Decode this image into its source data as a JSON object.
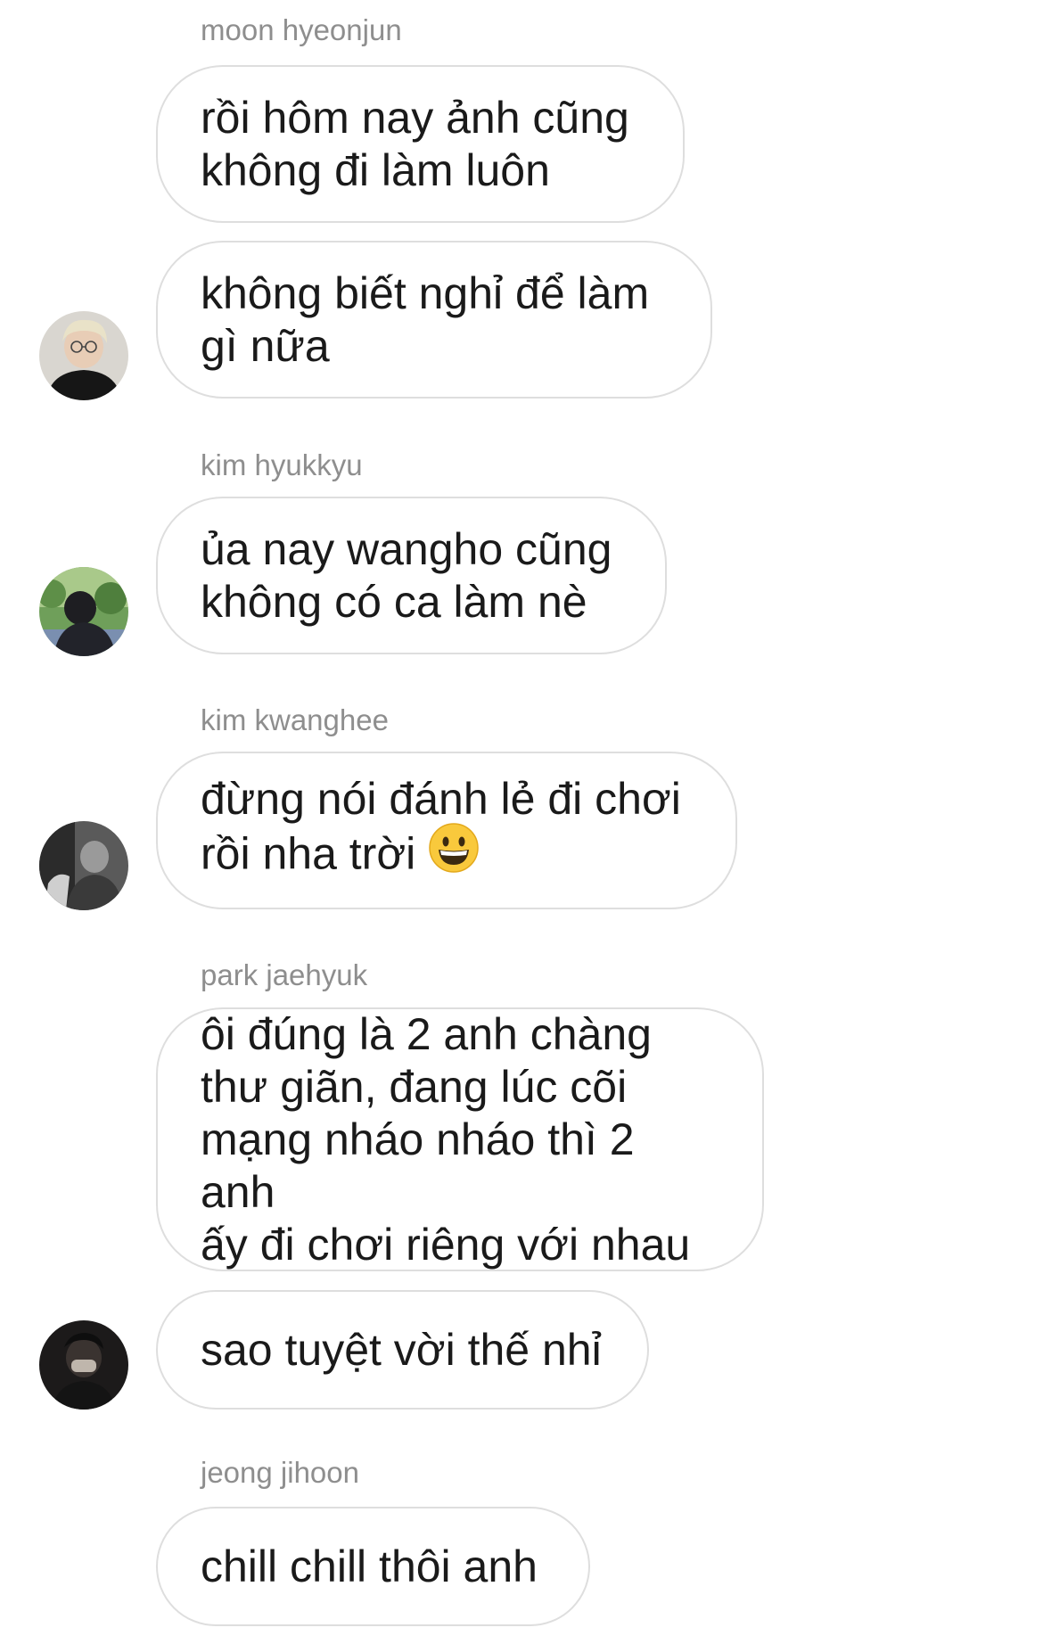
{
  "thread": {
    "groups": [
      {
        "sender": "moon hyeonjun",
        "messages": [
          "rồi hôm nay ảnh cũng\nkhông đi làm luôn",
          "không biết nghỉ để làm\ngì nữa"
        ],
        "avatar": "avatar-blonde-glasses"
      },
      {
        "sender": "kim hyukkyu",
        "messages": [
          "ủa nay wangho cũng\nkhông có ca làm nè"
        ],
        "avatar": "avatar-outdoor-trees"
      },
      {
        "sender": "kim kwanghee",
        "messages": [
          "đừng nói đánh lẻ đi chơi\nrồi nha trời"
        ],
        "emoji": "grinning-face-emoji",
        "avatar": "avatar-monochrome"
      },
      {
        "sender": "park jaehyuk",
        "messages": [
          "ôi đúng là 2 anh chàng\nthư giãn, đang lúc cõi\nmạng nháo nháo thì 2 anh\nấy đi chơi riêng với nhau",
          "sao tuyệt vời thế nhỉ"
        ],
        "avatar": "avatar-dark-hands-face"
      },
      {
        "sender": "jeong jihoon",
        "messages": [
          "chill chill thôi anh"
        ]
      }
    ]
  }
}
